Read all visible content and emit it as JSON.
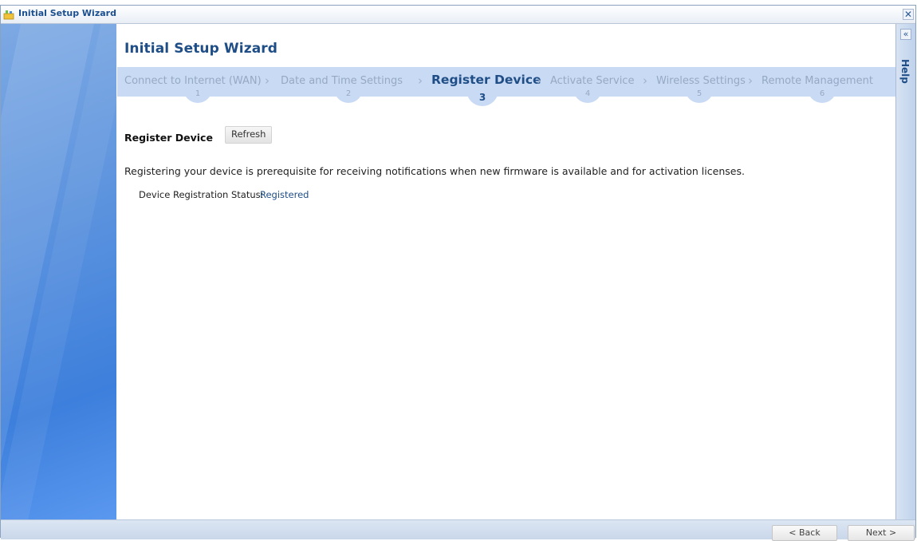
{
  "window": {
    "title": "Initial Setup Wizard",
    "close_glyph": "✕"
  },
  "content": {
    "page_title": "Initial Setup Wizard",
    "steps": [
      {
        "label": "Connect to Internet (WAN)",
        "number": "1",
        "active": false
      },
      {
        "label": "Date and Time Settings",
        "number": "2",
        "active": false
      },
      {
        "label": "Register Device",
        "number": "3",
        "active": true
      },
      {
        "label": "Activate Service",
        "number": "4",
        "active": false
      },
      {
        "label": "Wireless Settings",
        "number": "5",
        "active": false
      },
      {
        "label": "Remote Management",
        "number": "6",
        "active": false
      }
    ],
    "section_title": "Register Device",
    "refresh_label": "Refresh",
    "description": "Registering your device is prerequisite for receiving notifications when new firmware is available and for activation licenses.",
    "status_label": "Device Registration Status:",
    "status_value": "Registered"
  },
  "help": {
    "collapse_glyph": "«",
    "label": "Help"
  },
  "footer": {
    "back_label": "< Back",
    "next_label": "Next >"
  },
  "colors": {
    "accent": "#1f4e87",
    "step_bar": "#c9daf4",
    "left_panel": "#4a88dd"
  },
  "icons": {
    "window_icon": "wizard-app-icon",
    "close": "close-icon",
    "chevron": "chevron-right-icon",
    "help_collapse": "double-chevron-left-icon"
  }
}
